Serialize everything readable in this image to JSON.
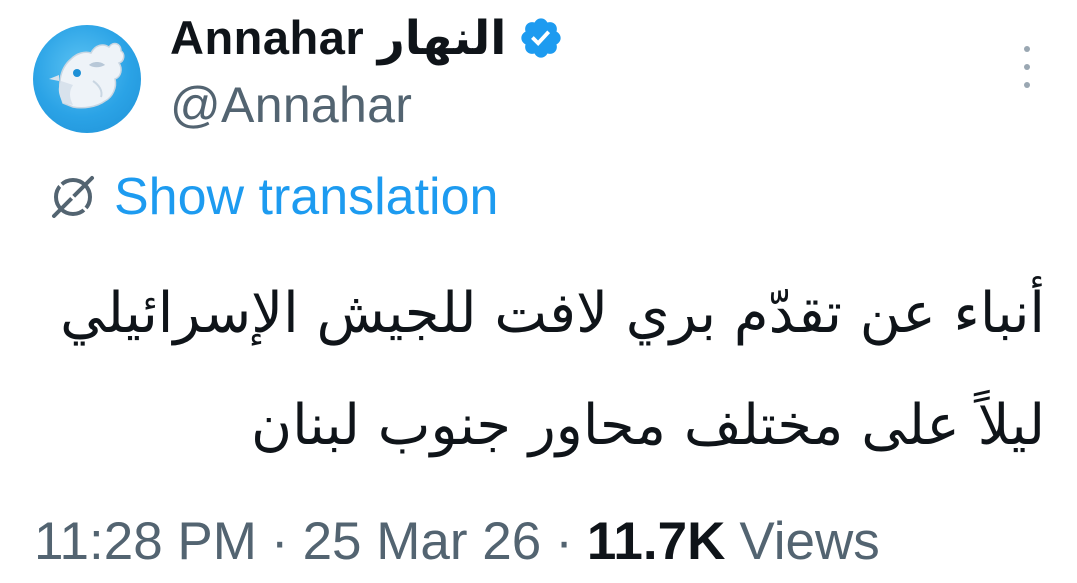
{
  "author": {
    "display_name": "Annahar",
    "arabic_name": "النهار",
    "handle": "@Annahar",
    "verified_color": "#1d9bf0",
    "avatar_color": "#2ba3e6"
  },
  "icons": {
    "avatar": "rooster-logo-icon",
    "verified": "verified-badge-icon",
    "more": "more-vertical-icon",
    "translate": "globe-translate-icon"
  },
  "translation": {
    "label": "Show translation"
  },
  "tweet": {
    "lines": [
      "أنباء عن تقدّم بري لافت للجيش الإسرائيلي",
      "ليلاً على مختلف محاور جنوب لبنان"
    ]
  },
  "meta": {
    "time": "11:28 PM",
    "separator": "·",
    "date": "25 Mar 26",
    "views_count": "11.7K",
    "views_label": "Views"
  },
  "colors": {
    "link": "#1d9bf0",
    "secondary_text": "#536471",
    "primary_text": "#0f1419"
  }
}
